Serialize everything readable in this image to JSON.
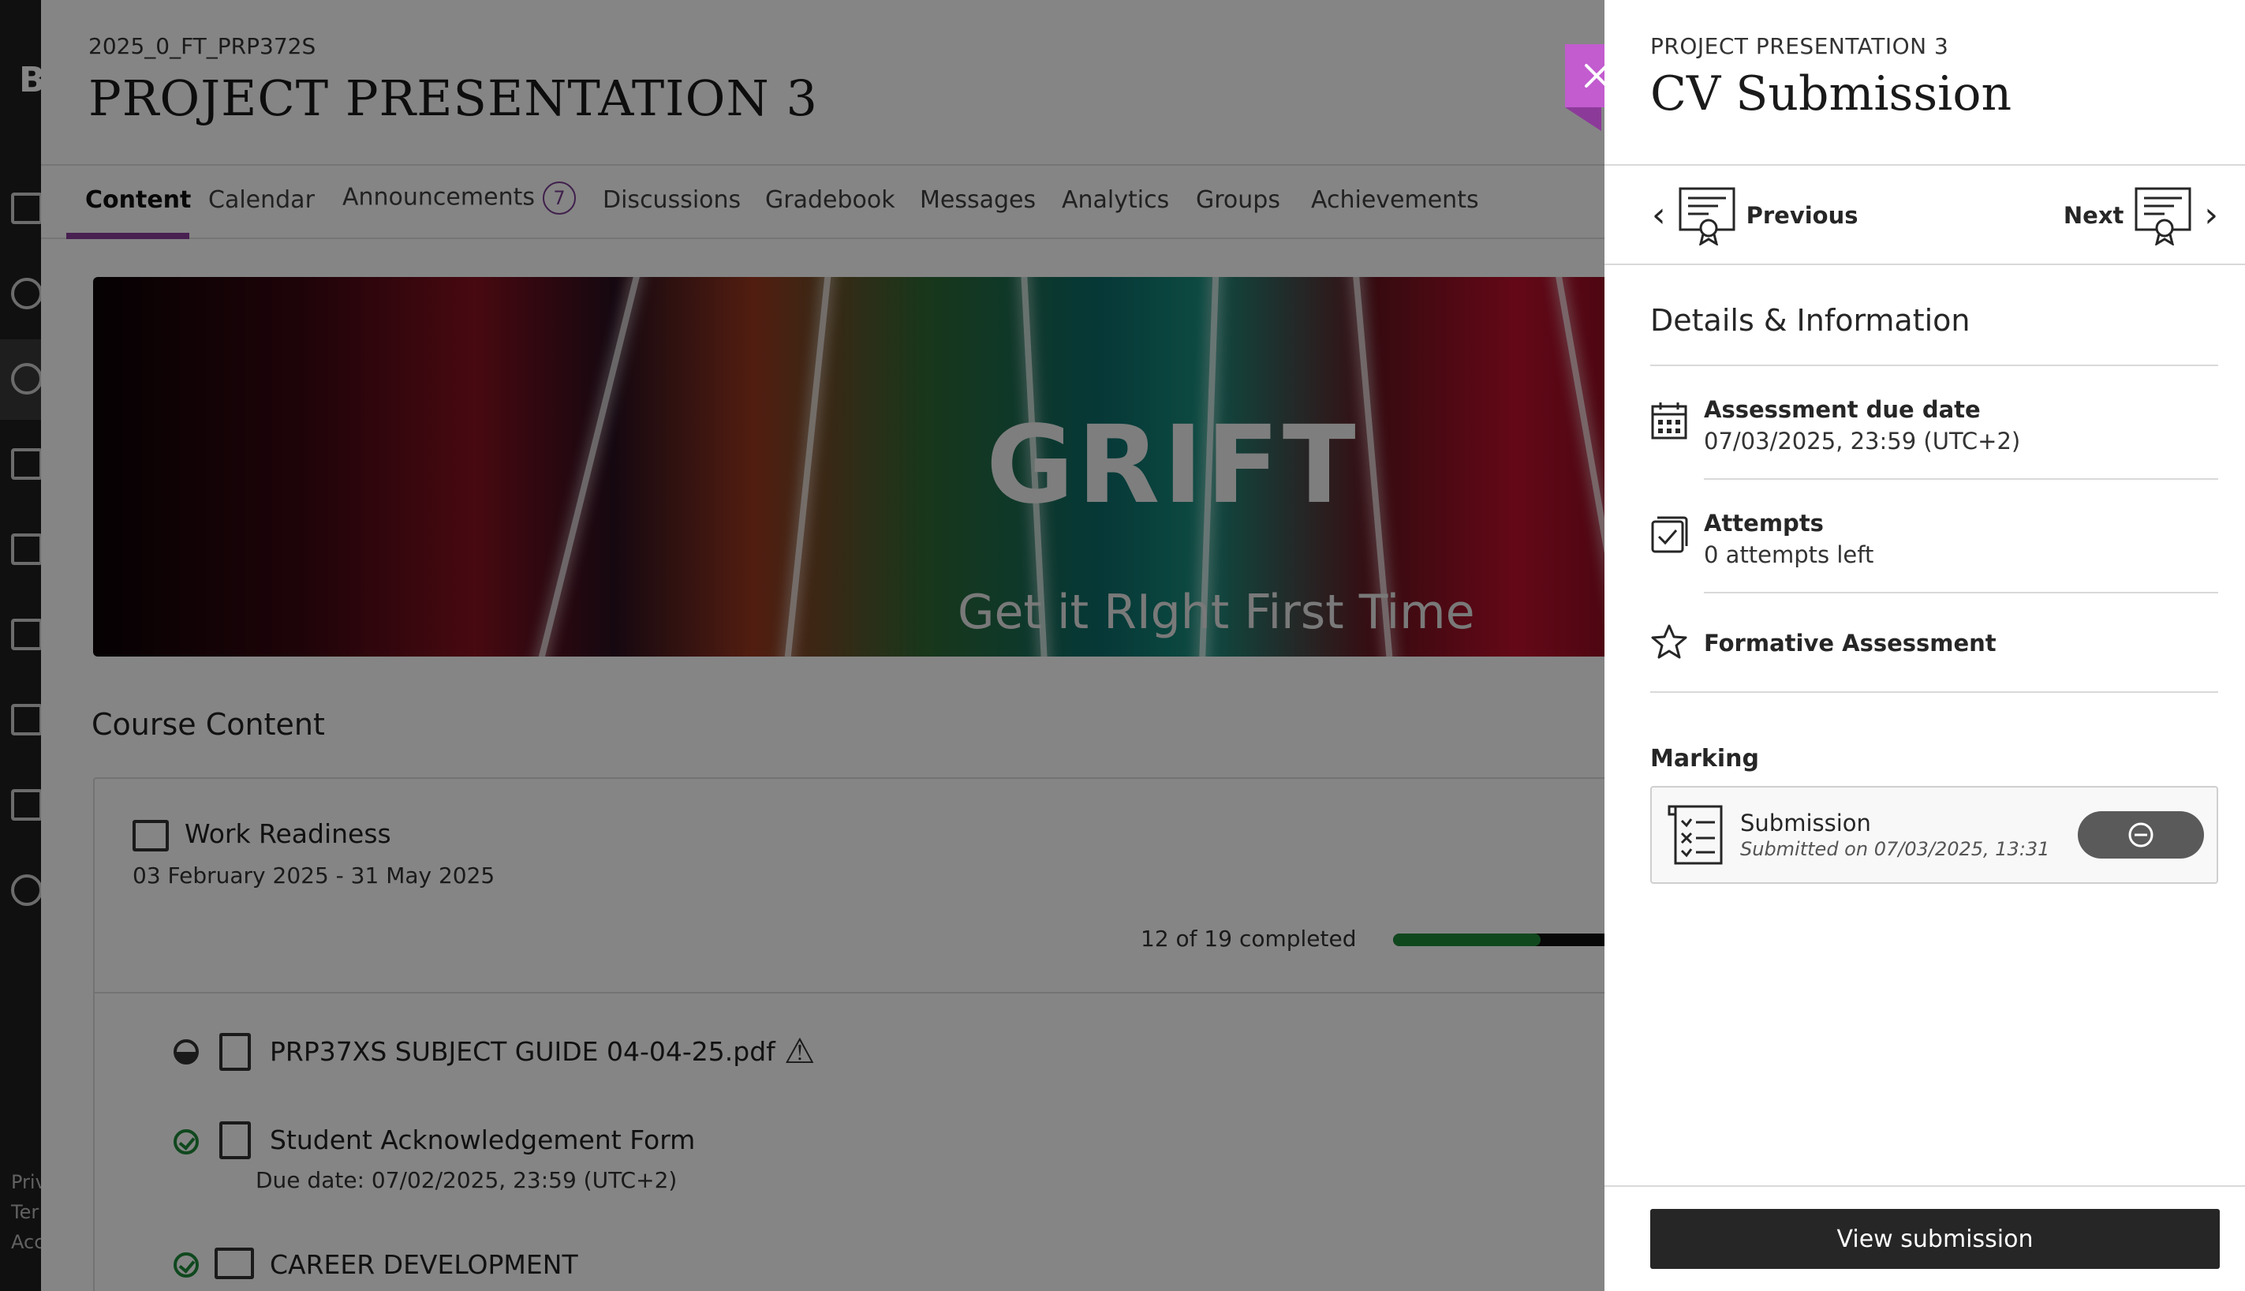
{
  "rail": {
    "logo_letter": "B",
    "footer_lines": [
      "Priv",
      "Ter",
      "Acc"
    ]
  },
  "course": {
    "code": "2025_0_FT_PRP372S",
    "title": "PROJECT PRESENTATION 3"
  },
  "tabs": [
    {
      "label": "Content",
      "active": true
    },
    {
      "label": "Calendar"
    },
    {
      "label": "Announcements",
      "badge": "7"
    },
    {
      "label": "Discussions"
    },
    {
      "label": "Gradebook"
    },
    {
      "label": "Messages"
    },
    {
      "label": "Analytics"
    },
    {
      "label": "Groups"
    },
    {
      "label": "Achievements"
    }
  ],
  "banner": {
    "headline": "GRIFT",
    "tagline": "Get it RIght First Time"
  },
  "course_content": {
    "heading": "Course Content",
    "module": {
      "title": "Work Readiness",
      "dates": "03 February 2025 - 31 May 2025",
      "progress_text": "12 of 19 completed",
      "progress_fraction": 0.6316
    },
    "items": [
      {
        "title": "PRP37XS SUBJECT GUIDE 04-04-25.pdf",
        "status": "partial",
        "icon": "document-icon"
      },
      {
        "title": "Student Acknowledgement Form",
        "subtitle": "Due date: 07/02/2025, 23:59 (UTC+2)",
        "status": "complete",
        "icon": "form-icon"
      },
      {
        "title": "CAREER DEVELOPMENT",
        "status": "complete",
        "icon": "presentation-icon"
      }
    ]
  },
  "panel": {
    "kicker": "PROJECT PRESENTATION 3",
    "title": "CV Submission",
    "nav": {
      "previous": "Previous",
      "next": "Next"
    },
    "details_heading": "Details & Information",
    "details": [
      {
        "label": "Assessment due date",
        "value": "07/03/2025, 23:59 (UTC+2)",
        "icon": "calendar-icon"
      },
      {
        "label": "Attempts",
        "value": "0 attempts left",
        "icon": "checkbox-icon"
      },
      {
        "label": "Formative Assessment",
        "value": "",
        "icon": "star-icon"
      }
    ],
    "marking_heading": "Marking",
    "submission": {
      "title": "Submission",
      "meta": "Submitted on 07/03/2025, 13:31"
    },
    "view_button": "View submission"
  },
  "colors": {
    "accent_purple": "#8a3f9c",
    "close_tab": "#c25ccf",
    "progress_green": "#1f8a3a",
    "dark_button": "#262626"
  }
}
